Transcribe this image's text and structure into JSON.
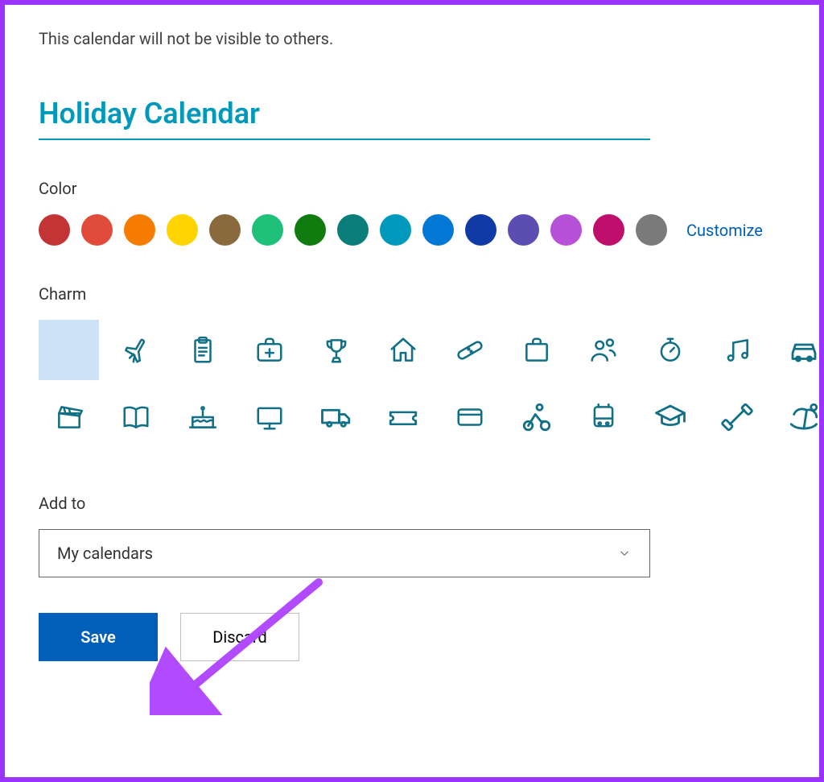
{
  "note": "This calendar will not be visible to others.",
  "title": "Holiday Calendar",
  "sections": {
    "color_label": "Color",
    "charm_label": "Charm",
    "addto_label": "Add to"
  },
  "colors": [
    "#c33434",
    "#e14b3b",
    "#f57c00",
    "#ffd400",
    "#8a6a3d",
    "#1fc17a",
    "#107c10",
    "#0b7e7c",
    "#0099bc",
    "#0078d4",
    "#103ba6",
    "#5c4db2",
    "#b651d8",
    "#bf0f6c",
    "#7a7a7a"
  ],
  "customize_label": "Customize",
  "charms": [
    {
      "name": "none",
      "selected": true
    },
    {
      "name": "airplane"
    },
    {
      "name": "clipboard"
    },
    {
      "name": "first-aid"
    },
    {
      "name": "trophy"
    },
    {
      "name": "home"
    },
    {
      "name": "bandage"
    },
    {
      "name": "briefcase"
    },
    {
      "name": "people"
    },
    {
      "name": "stopwatch"
    },
    {
      "name": "music"
    },
    {
      "name": "car"
    },
    {
      "name": "clapperboard"
    },
    {
      "name": "book"
    },
    {
      "name": "cake"
    },
    {
      "name": "monitor"
    },
    {
      "name": "truck"
    },
    {
      "name": "ticket"
    },
    {
      "name": "credit-card"
    },
    {
      "name": "cycling"
    },
    {
      "name": "bus"
    },
    {
      "name": "graduation"
    },
    {
      "name": "dumbbell"
    },
    {
      "name": "beach"
    }
  ],
  "addto": {
    "selected": "My calendars"
  },
  "buttons": {
    "save": "Save",
    "discard": "Discard"
  }
}
